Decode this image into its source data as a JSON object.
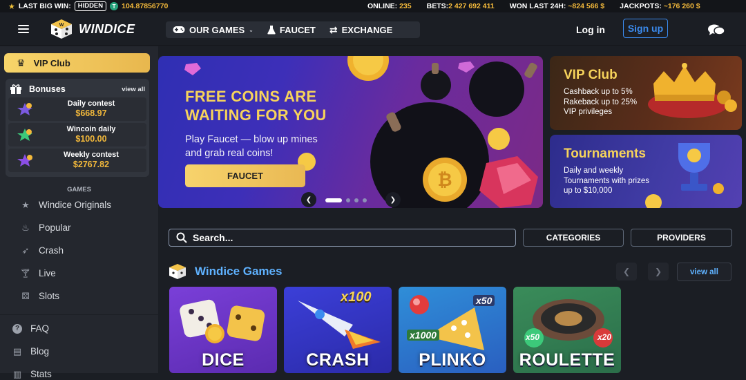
{
  "ticker": {
    "last_big_win_label": "LAST BIG WIN:",
    "hidden_badge": "HIDDEN",
    "coin_symbol": "T",
    "last_big_win_value": "104.87856770",
    "online_label": "ONLINE:",
    "online_value": "235",
    "bets_label": "BETS:",
    "bets_value": "2 427 692 411",
    "won_label": "WON LAST 24H:",
    "won_value": "~824 566 $",
    "jackpots_label": "JACKPOTS:",
    "jackpots_value": "~176 260 $"
  },
  "header": {
    "logo_text": "WINDICE",
    "nav": [
      {
        "label": "OUR GAMES",
        "icon": "gamepad-icon"
      },
      {
        "label": "FAUCET",
        "icon": "flask-icon"
      },
      {
        "label": "EXCHANGE",
        "icon": "exchange-icon"
      }
    ],
    "login": "Log in",
    "signup": "Sign up"
  },
  "sidebar": {
    "vip": "VIP Club",
    "bonuses": {
      "title": "Bonuses",
      "view_all": "view all",
      "items": [
        {
          "title": "Daily contest",
          "value": "$668.97"
        },
        {
          "title": "Wincoin daily",
          "value": "$100.00"
        },
        {
          "title": "Weekly contest",
          "value": "$2767.82"
        }
      ]
    },
    "games_title": "GAMES",
    "games": [
      "Windice Originals",
      "Popular",
      "Crash",
      "Live",
      "Slots"
    ],
    "links": [
      "FAQ",
      "Blog",
      "Stats"
    ]
  },
  "banner": {
    "headline_line1": "FREE COINS ARE",
    "headline_line2": "WAITING FOR YOU",
    "text_line1": "Play Faucet — blow up mines",
    "text_line2": "and grab real coins!",
    "button": "FAUCET"
  },
  "promos": {
    "vip": {
      "title": "VIP Club",
      "lines": [
        "Cashback up to 5%",
        "Rakeback up to 25%",
        "VIP privileges"
      ]
    },
    "tournaments": {
      "title": "Tournaments",
      "lines": [
        "Daily and weekly",
        "Tournaments with prizes",
        "up to $10,000"
      ]
    }
  },
  "search": {
    "placeholder": "Search..."
  },
  "filters": {
    "categories": "CATEGORIES",
    "providers": "PROVIDERS"
  },
  "section": {
    "title": "Windice Games",
    "view_all": "view all"
  },
  "games": [
    {
      "name": "DICE",
      "badge": ""
    },
    {
      "name": "CRASH",
      "badge": "x100"
    },
    {
      "name": "PLINKO",
      "badge": "x50",
      "badge2": "x1000"
    },
    {
      "name": "ROULETTE",
      "badge": "x50",
      "badge2": "x20"
    }
  ],
  "colors": {
    "accent_gold": "#f3b93b",
    "accent_blue": "#3b8cf0",
    "bg": "#1b1e24"
  }
}
